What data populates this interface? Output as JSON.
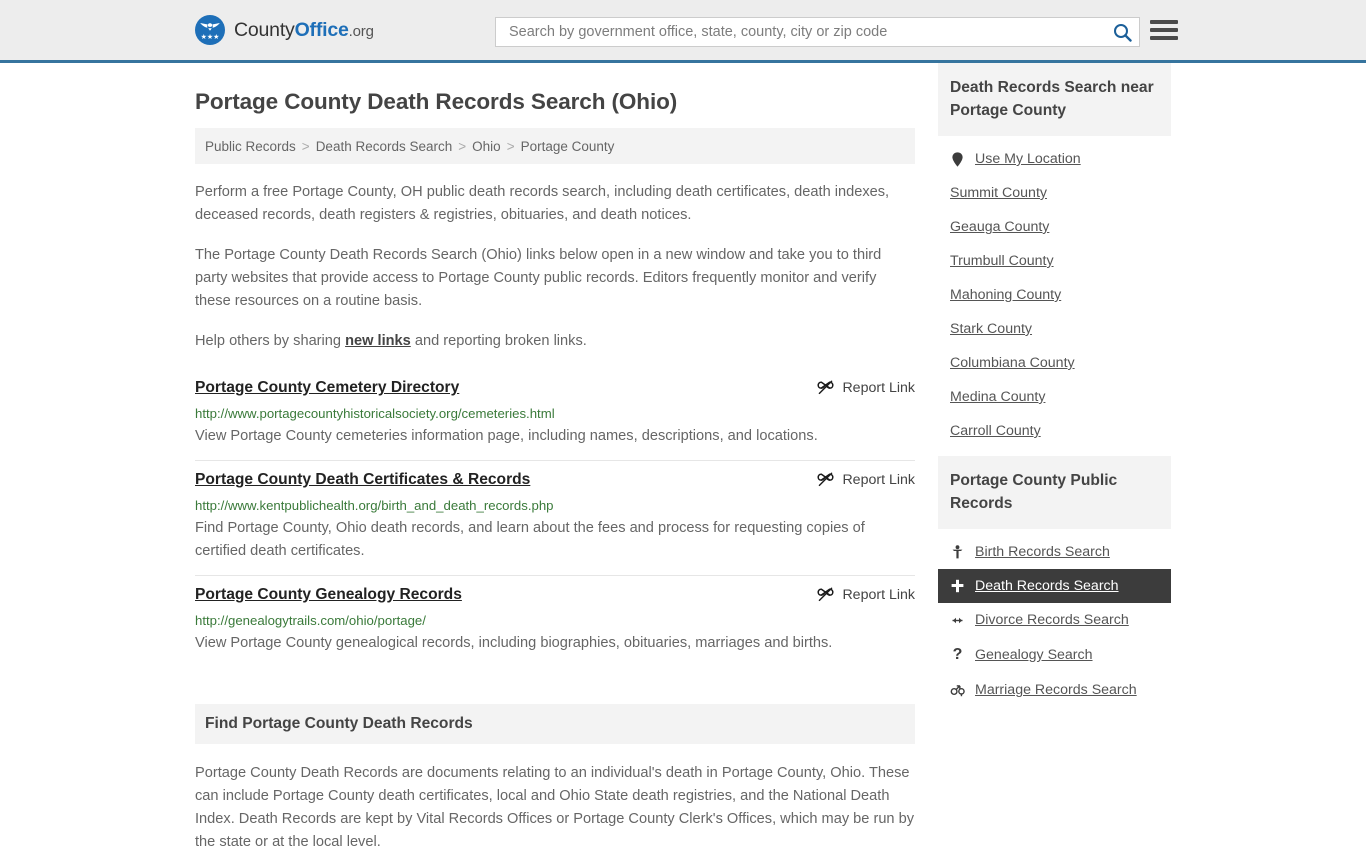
{
  "header": {
    "brand": {
      "part1": "County",
      "part2": "Office",
      "part3": ".org"
    },
    "search": {
      "placeholder": "Search by government office, state, county, city or zip code",
      "value": "",
      "icon": "search-icon"
    },
    "menu_icon": "hamburger-menu-icon",
    "accent_color": "#36749e",
    "background_color": "#ededed"
  },
  "main": {
    "title": "Portage County Death Records Search (Ohio)",
    "breadcrumb": [
      {
        "label": "Public Records"
      },
      {
        "label": "Death Records Search"
      },
      {
        "label": "Ohio"
      },
      {
        "label": "Portage County"
      }
    ],
    "breadcrumb_separator": ">",
    "intro": {
      "p1": "Perform a free Portage County, OH public death records search, including death certificates, death indexes, deceased records, death registers & registries, obituaries, and death notices.",
      "p2": "The Portage County Death Records Search (Ohio) links below open in a new window and take you to third party websites that provide access to Portage County public records. Editors frequently monitor and verify these resources on a routine basis.",
      "p3_before": "Help others by sharing ",
      "p3_link": "new links",
      "p3_after": " and reporting broken links."
    },
    "report_link_label": "Report Link",
    "report_link_icon": "unlink-icon",
    "results": [
      {
        "title": "Portage County Cemetery Directory",
        "url": "http://www.portagecountyhistoricalsociety.org/cemeteries.html",
        "description": "View Portage County cemeteries information page, including names, descriptions, and locations."
      },
      {
        "title": "Portage County Death Certificates & Records",
        "url": "http://www.kentpublichealth.org/birth_and_death_records.php",
        "description": "Find Portage County, Ohio death records, and learn about the fees and process for requesting copies of certified death certificates."
      },
      {
        "title": "Portage County Genealogy Records",
        "url": "http://genealogytrails.com/ohio/portage/",
        "description": "View Portage County genealogical records, including biographies, obituaries, marriages and births."
      }
    ],
    "find_section": {
      "heading": "Find Portage County Death Records",
      "paragraph": "Portage County Death Records are documents relating to an individual's death in Portage County, Ohio. These can include Portage County death certificates, local and Ohio State death registries, and the National Death Index. Death Records are kept by Vital Records Offices or Portage County Clerk's Offices, which may be run by the state or at the local level."
    }
  },
  "sidebar": {
    "nearby": {
      "heading": "Death Records Search near Portage County",
      "use_my_location": {
        "label": "Use My Location",
        "icon": "map-pin-icon"
      },
      "counties": [
        {
          "label": "Summit County"
        },
        {
          "label": "Geauga County"
        },
        {
          "label": "Trumbull County"
        },
        {
          "label": "Mahoning County"
        },
        {
          "label": "Stark County"
        },
        {
          "label": "Columbiana County"
        },
        {
          "label": "Medina County"
        },
        {
          "label": "Carroll County"
        }
      ]
    },
    "public_records": {
      "heading": "Portage County Public Records",
      "items": [
        {
          "label": "Birth Records Search",
          "icon": "baby-icon",
          "active": false
        },
        {
          "label": "Death Records Search",
          "icon": "cross-icon",
          "active": true
        },
        {
          "label": "Divorce Records Search",
          "icon": "left-right-arrow-icon",
          "active": false
        },
        {
          "label": "Genealogy Search",
          "icon": "question-mark-icon",
          "active": false
        },
        {
          "label": "Marriage Records Search",
          "icon": "gender-symbols-icon",
          "active": false
        }
      ],
      "active_background": "#3c3c3c"
    }
  }
}
